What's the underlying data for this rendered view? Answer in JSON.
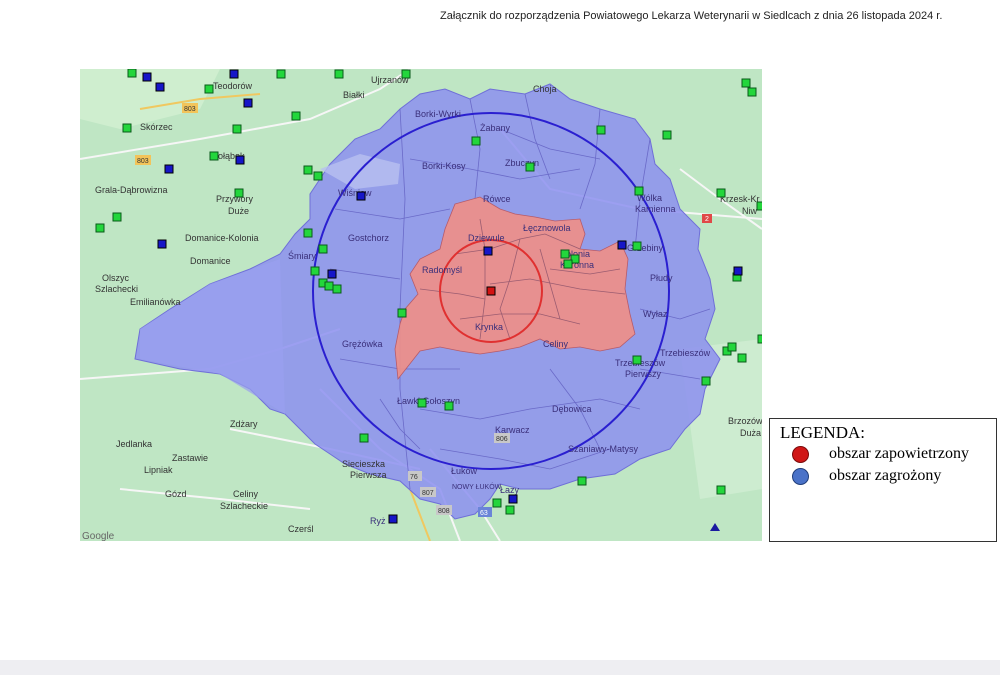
{
  "header": {
    "text": "Załącznik do rozporządzenia Powiatowego Lekarza Weterynarii w Siedlcach z dnia 26 listopada 2024 r."
  },
  "legend": {
    "title": "LEGENDA:",
    "items": [
      {
        "label": "obszar zapowietrzony",
        "color": "#d01717"
      },
      {
        "label": "obszar zagrożony",
        "color": "#4a72c8"
      }
    ]
  },
  "map": {
    "colors": {
      "background": "#bfe6c4",
      "threatened_zone": "#8c8ff0",
      "infected_zone": "#f08f86",
      "circle_large": "#2a1fd0",
      "circle_small": "#e03030",
      "farm_green": "#23d63c",
      "farm_blue": "#1616c8"
    },
    "place_names": {
      "outside": [
        "Teodorów",
        "Skórzec",
        "Gołąbek",
        "Grala-Dąbrowizna",
        "Przywory Duże",
        "Domanice-Kolonia",
        "Domanice",
        "Olszyc Szlachecki",
        "Emilianówka",
        "Zdżary",
        "Jedlanka",
        "Zastawie",
        "Lipniak",
        "Gózd",
        "Celiny Szlacheckie",
        "Czerśl",
        "Siecieszka Pierwsza",
        "Białki",
        "Ujrzanów",
        "Choja",
        "Krzesk-Królowa Niwa",
        "Brzozów Duża"
      ],
      "inside": [
        "Borki-Wyrki",
        "Żabany",
        "Borki-Kosy",
        "Zbuczyn",
        "Wiśniew",
        "Gostchorz",
        "Rówce",
        "Dziewule",
        "Łęcznowola",
        "Kolonia Koronna",
        "Śmiary",
        "Radomyśl",
        "Krynka",
        "Wola Kamienna",
        "Grzebiny",
        "Płudy",
        "Wyłaz",
        "Grężówka",
        "Celiny",
        "Trzebieszów",
        "Trzebieszów Pierwszy",
        "Ławki Gołoszyn",
        "Dębowica",
        "Karwacz",
        "Szaniawy-Matysy",
        "Łuków",
        "Nowy Łuków",
        "Łazy",
        "Ryż"
      ]
    },
    "road_numbers": [
      "803",
      "803",
      "2",
      "806",
      "76",
      "807",
      "808",
      "63"
    ],
    "attribution": "Google"
  }
}
